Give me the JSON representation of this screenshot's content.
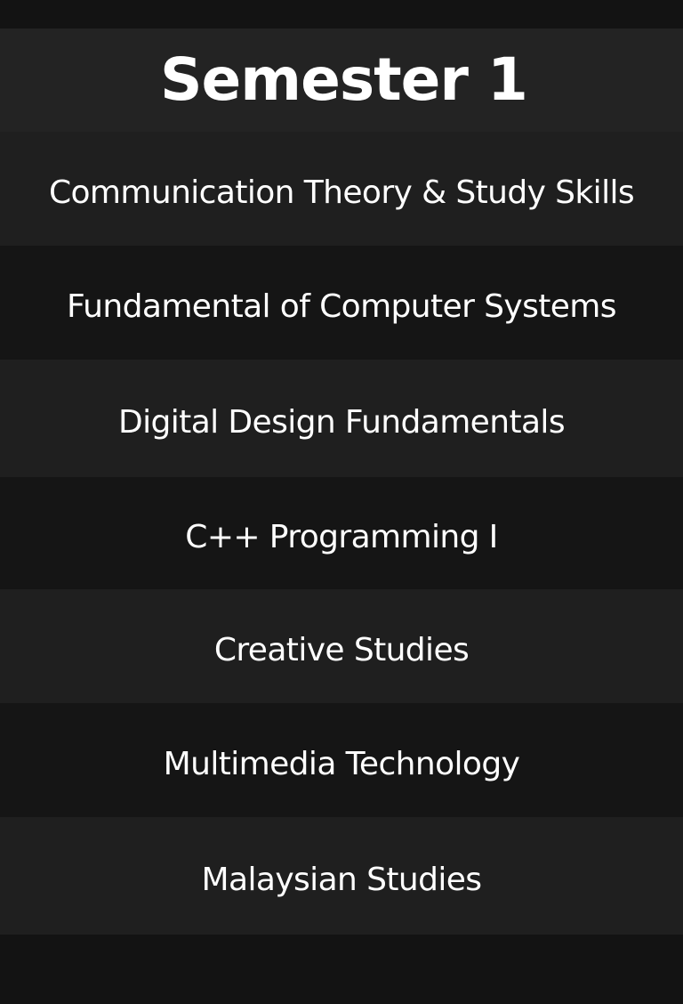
{
  "header": {
    "title": "Semester 1"
  },
  "courses": [
    {
      "label": "Communication Theory & Study Skills"
    },
    {
      "label": "Fundamental of Computer Systems"
    },
    {
      "label": "Digital Design Fundamentals"
    },
    {
      "label": "C++ Programming I"
    },
    {
      "label": "Creative Studies"
    },
    {
      "label": "Multimedia Technology"
    },
    {
      "label": "Malaysian Studies"
    }
  ],
  "colors": {
    "background": "#131313",
    "header_bg": "#232323",
    "row_light": "#1f1f1f",
    "row_dark": "#151515",
    "text": "#ffffff"
  }
}
